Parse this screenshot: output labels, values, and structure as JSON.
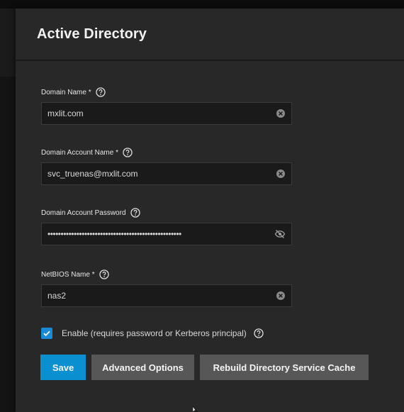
{
  "dialog": {
    "title": "Active Directory"
  },
  "fields": {
    "domain_name": {
      "label": "Domain Name",
      "required_mark": "*",
      "value": "mxlit.com"
    },
    "domain_account_name": {
      "label": "Domain Account Name",
      "required_mark": "*",
      "value": "svc_truenas@mxlit.com"
    },
    "domain_account_password": {
      "label": "Domain Account Password",
      "value": "•••••••••••••••••••••••••••••••••••••••••••••••••••"
    },
    "netbios_name": {
      "label": "NetBIOS Name",
      "required_mark": "*",
      "value": "nas2"
    }
  },
  "enable": {
    "label": "Enable (requires password or Kerberos principal)",
    "checked": true
  },
  "buttons": {
    "save": "Save",
    "advanced": "Advanced Options",
    "rebuild": "Rebuild Directory Service Cache"
  },
  "icons": {
    "help": "help-circle-icon",
    "clear": "clear-x-circle-icon",
    "visibility": "eye-off-icon",
    "check": "check-icon"
  },
  "colors": {
    "primary": "#0a8fd0",
    "secondary": "#575757",
    "checkbox": "#1a8ad6",
    "panel": "#282828",
    "input_bg": "#1a1a1a"
  }
}
